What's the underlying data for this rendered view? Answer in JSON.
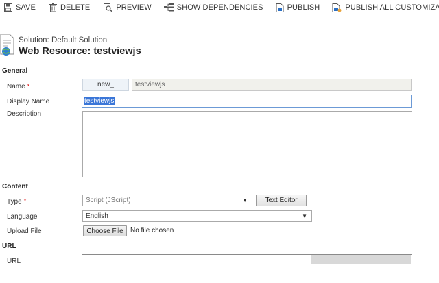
{
  "toolbar": {
    "save": "SAVE",
    "delete": "DELETE",
    "preview": "PREVIEW",
    "show_dependencies": "SHOW DEPENDENCIES",
    "publish": "PUBLISH",
    "publish_all": "PUBLISH ALL CUSTOMIZA..."
  },
  "header": {
    "solution": "Solution: Default Solution",
    "title": "Web Resource: testviewjs"
  },
  "general": {
    "section_title": "General",
    "name_label": "Name",
    "name_prefix": "new_",
    "name_value": "testviewjs",
    "display_name_label": "Display Name",
    "display_name_value": "testviewjs",
    "description_label": "Description"
  },
  "content": {
    "section_title": "Content",
    "type_label": "Type",
    "type_value": "Script (JScript)",
    "text_editor": "Text Editor",
    "language_label": "Language",
    "language_value": "English",
    "upload_label": "Upload File",
    "choose_file": "Choose File",
    "no_file": "No file chosen"
  },
  "url": {
    "section_title": "URL",
    "url_label": "URL"
  },
  "required_mark": "*"
}
